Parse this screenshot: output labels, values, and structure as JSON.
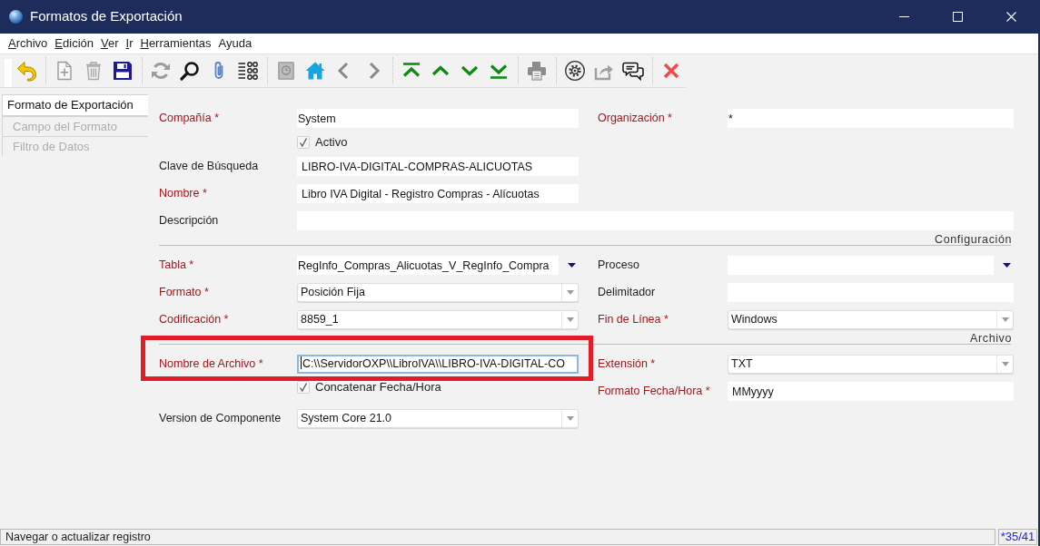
{
  "window": {
    "title": "Formatos de Exportación"
  },
  "menu": [
    {
      "label": "Archivo",
      "mnemonic": true
    },
    {
      "label": "Edición",
      "mnemonic": true
    },
    {
      "label": "Ver",
      "mnemonic": true
    },
    {
      "label": "Ir",
      "mnemonic": true
    },
    {
      "label": "Herramientas",
      "mnemonic": true
    },
    {
      "label": "Ayuda",
      "mnemonic": false
    }
  ],
  "tabs": [
    {
      "label": "Formato de Exportación",
      "selected": true
    },
    {
      "label": "Campo del Formato",
      "selected": false
    },
    {
      "label": "Filtro de Datos",
      "selected": false
    }
  ],
  "form": {
    "sections": [
      {
        "rows": [
          {
            "left": {
              "kind": "lookup",
              "label": "Compañía *",
              "mandatory": true,
              "value": "System",
              "dropdown": false,
              "focused": false,
              "highlighted": false
            },
            "right": {
              "kind": "lookup",
              "label": "Organización *",
              "mandatory": true,
              "value": "*",
              "dropdown": false,
              "focused": false,
              "highlighted": false
            }
          },
          {
            "left": {
              "kind": "checkbox",
              "label": "Activo",
              "checked": true
            }
          },
          {
            "left": {
              "kind": "text",
              "label": "Clave de Búsqueda",
              "mandatory": false,
              "value": "LIBRO-IVA-DIGITAL-COMPRAS-ALICUOTAS",
              "focused": false,
              "highlighted": false
            }
          },
          {
            "left": {
              "kind": "text",
              "label": "Nombre *",
              "mandatory": true,
              "value": "Libro IVA Digital - Registro Compras - Alícuotas",
              "focused": false,
              "highlighted": false
            }
          },
          {
            "wide": {
              "kind": "text",
              "label": "Descripción",
              "mandatory": false,
              "focused": false,
              "highlighted": false
            }
          }
        ]
      },
      {
        "title": "Configuración",
        "rows": [
          {
            "left": {
              "kind": "lookup",
              "label": "Tabla *",
              "mandatory": true,
              "value": "RegInfo_Compras_Alicuotas_V_RegInfo_Compra",
              "dropdown": true,
              "focused": false,
              "highlighted": false
            },
            "right": {
              "kind": "lookup",
              "label": "Proceso",
              "mandatory": false,
              "dropdown": true,
              "focused": false,
              "highlighted": false
            }
          },
          {
            "left": {
              "kind": "combo",
              "label": "Formato *",
              "mandatory": true,
              "value": "Posición Fija",
              "focused": false,
              "highlighted": false
            },
            "right": {
              "kind": "text",
              "label": "Delimitador",
              "mandatory": false,
              "focused": false,
              "highlighted": false
            }
          },
          {
            "left": {
              "kind": "combo",
              "label": "Codificación *",
              "mandatory": true,
              "value": "8859_1",
              "focused": false,
              "highlighted": false
            },
            "right": {
              "kind": "combo",
              "label": "Fin de Línea *",
              "mandatory": true,
              "value": "Windows",
              "focused": false,
              "highlighted": false
            }
          }
        ]
      },
      {
        "title": "Archivo",
        "rows": [
          {
            "left": {
              "kind": "text",
              "label": "Nombre de Archivo *",
              "mandatory": true,
              "value": "C:\\\\ServidorOXP\\\\LibroIVA\\\\LIBRO-IVA-DIGITAL-CO",
              "focused": true,
              "highlighted": true
            },
            "right": {
              "kind": "combo",
              "label": "Extensión *",
              "mandatory": true,
              "value": "TXT",
              "focused": false,
              "highlighted": false
            }
          },
          {
            "left": {
              "kind": "checkbox",
              "label": "Concatenar Fecha/Hora",
              "checked": true
            },
            "right": {
              "kind": "text",
              "label": "Formato Fecha/Hora *",
              "mandatory": true,
              "value": "MMyyyy",
              "focused": false,
              "highlighted": false
            }
          },
          {
            "left": {
              "kind": "combo",
              "label": "Version de Componente",
              "mandatory": false,
              "value": "System Core 21.0",
              "focused": false,
              "highlighted": false
            }
          }
        ]
      }
    ]
  },
  "status_bar": {
    "message": "Navegar o actualizar registro",
    "record": "*35/41"
  }
}
